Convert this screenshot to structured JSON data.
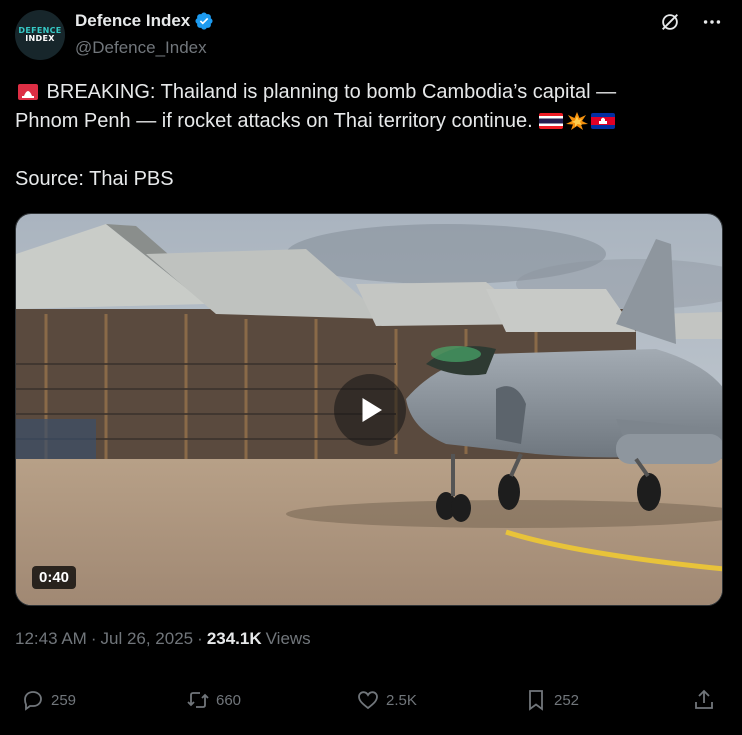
{
  "author": {
    "display_name": "Defence Index",
    "handle": "@Defence_Index",
    "avatar_line1": "DEFENCE",
    "avatar_line2": "INDEX",
    "verified_color": "#1d9bf0"
  },
  "header_icons": [
    "grok-icon",
    "more-icon"
  ],
  "post": {
    "line1": " BREAKING: Thailand is planning to bomb Cambodia’s capital —",
    "line2": "Phnom Penh — if rocket attacks on Thai territory continue. ",
    "source_line": "Source: Thai PBS",
    "emojis": [
      "rotating-light-icon",
      "thailand-flag-icon",
      "collision-icon",
      "cambodia-flag-icon"
    ]
  },
  "media": {
    "type": "video",
    "duration": "0:40",
    "description_icons": [
      "play-icon"
    ]
  },
  "meta": {
    "time": "12:43 AM",
    "separator": "·",
    "date": "Jul 26, 2025",
    "views_count": "234.1K",
    "views_label": "Views"
  },
  "actions": {
    "replies": "259",
    "reposts": "660",
    "likes": "2.5K",
    "bookmarks": "252"
  },
  "colors": {
    "background": "#000000",
    "text": "#e7e9ea",
    "secondary": "#71767b",
    "accent": "#1d9bf0"
  }
}
